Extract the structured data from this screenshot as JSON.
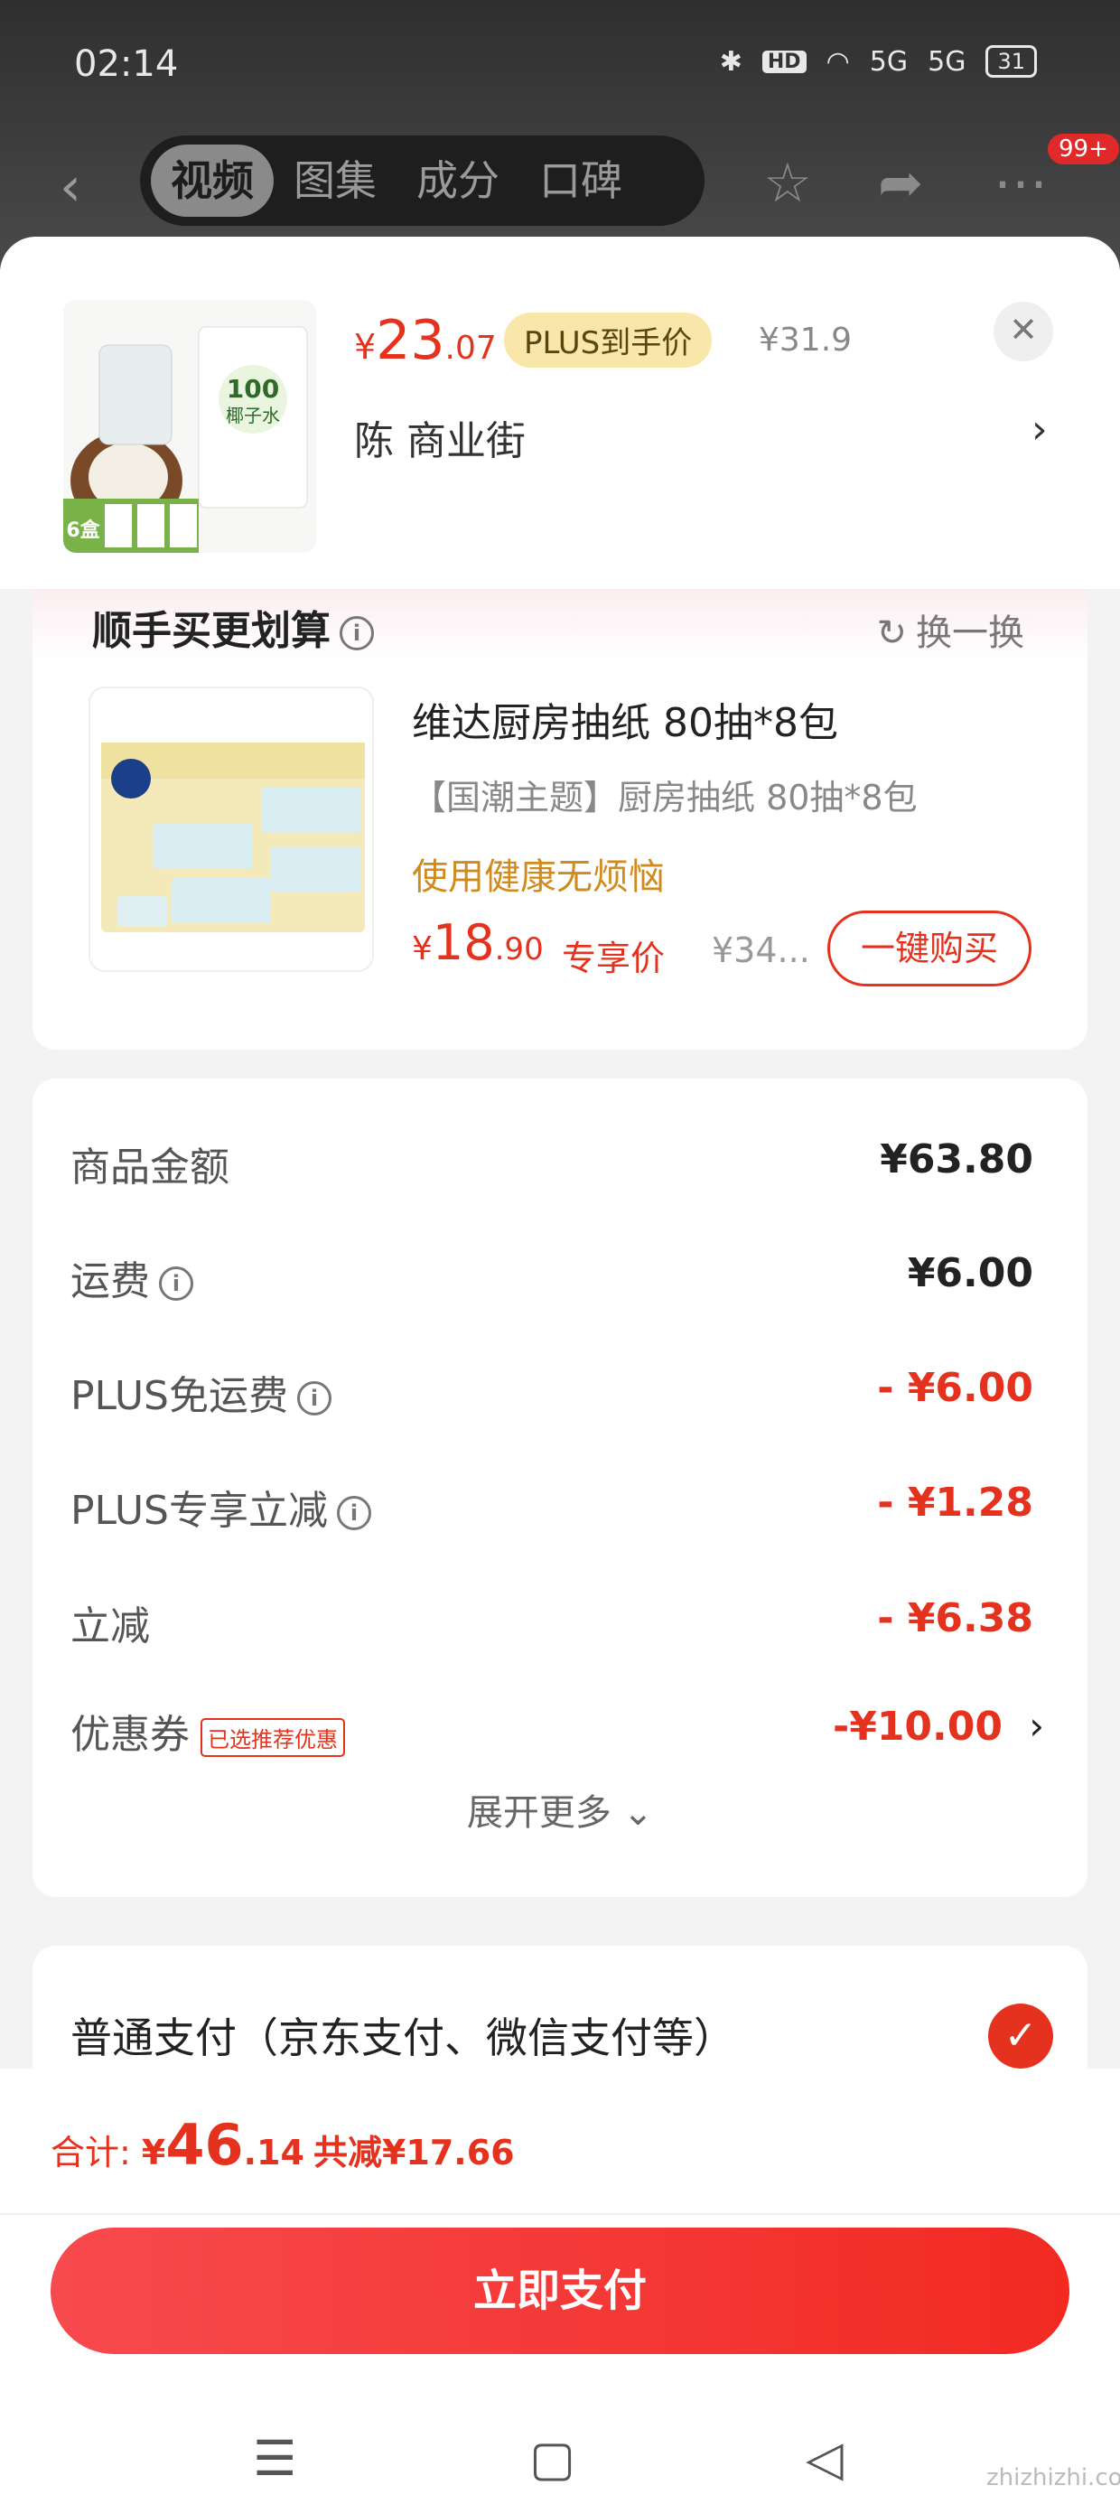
{
  "status_bar": {
    "time": "02:14",
    "hd": "HD",
    "signal_5g_a": "5G",
    "signal_5g_b": "5G",
    "battery": "31"
  },
  "nav": {
    "tabs": [
      "视频",
      "图集",
      "成分",
      "口碑"
    ],
    "badge": "99+"
  },
  "product": {
    "thumb_text": "100 椰子水",
    "thumb_badge": "6盒",
    "price_yen": "¥",
    "price_int": "23",
    "price_dec": ".07",
    "plus_tag": "PLUS到手价",
    "orig_price": "¥31.9",
    "shop": "陈  商业街",
    "close": "✕",
    "arrow": "›"
  },
  "upsell": {
    "title": "顺手买更划算",
    "swap_label": "换一换",
    "name": "维达厨房抽纸 80抽*8包",
    "sub": "【国潮主题】厨房抽纸 80抽*8包",
    "slogan": "使用健康无烦恼",
    "price_yen": "¥",
    "price_int": "18",
    "price_dec": ".90",
    "price_label": "专享价",
    "orig_price": "¥34...",
    "buy_label": "一键购买"
  },
  "cost": {
    "rows": [
      {
        "label": "商品金额",
        "value": "¥63.80"
      },
      {
        "label": "运费",
        "value": "¥6.00"
      },
      {
        "label": "PLUS免运费",
        "value": "- ¥6.00"
      },
      {
        "label": "PLUS专享立减",
        "value": "- ¥1.28"
      },
      {
        "label": "立减",
        "value": "- ¥6.38"
      },
      {
        "label": "优惠券",
        "value": "-¥10.00"
      }
    ],
    "coupon_tag": "已选推荐优惠",
    "expand": "展开更多 ⌄"
  },
  "payment": {
    "label": "普通支付（京东支付、微信支付等）"
  },
  "footer": {
    "total_label": "合计: ",
    "total_yen": "¥",
    "total_int": "46",
    "total_dec": ".14",
    "save": "共减¥17.66",
    "pay_button": "立即支付"
  },
  "watermark": "zhizhizhi.com",
  "colors": {
    "accent": "#e4321e",
    "plus_bg": "#f8e7a8",
    "slogan": "#d08a1e"
  }
}
